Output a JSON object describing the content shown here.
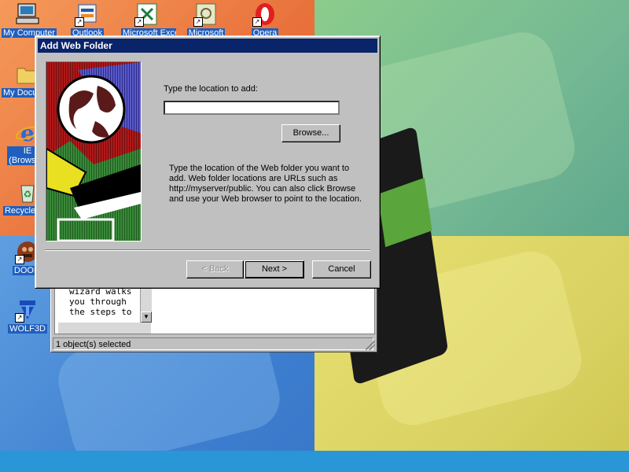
{
  "desktop": {
    "icons": [
      {
        "id": "my-computer",
        "label": "My Computer"
      },
      {
        "id": "outlook",
        "label": "Outlook"
      },
      {
        "id": "excel",
        "label": "Microsoft Excel"
      },
      {
        "id": "ms-other",
        "label": "Microsoft"
      },
      {
        "id": "opera",
        "label": "Opera"
      },
      {
        "id": "my-documents",
        "label": "My Documents"
      },
      {
        "id": "ie",
        "label": "IE (Browser)",
        "line1": "IE",
        "line2": "(Browser)"
      },
      {
        "id": "recycle",
        "label": "Recycle Bin"
      },
      {
        "id": "doom",
        "label": "DOOM"
      },
      {
        "id": "wolf3d",
        "label": "WOLF3D"
      }
    ]
  },
  "back_window": {
    "text_lines": [
      "wizard walks",
      "you through",
      "the steps to"
    ],
    "status": "1 object(s) selected"
  },
  "dialog": {
    "title": "Add Web Folder",
    "prompt_label": "Type the location to add:",
    "location_value": "",
    "browse_label": "Browse...",
    "description": "Type the location of the Web folder you want to add.  Web folder locations are URLs such as http://myserver/public.  You can also click Browse and use your Web browser to point to the location.",
    "buttons": {
      "back": "< Back",
      "next": "Next >",
      "cancel": "Cancel"
    }
  },
  "colors": {
    "titlebar": "#0a246a",
    "dialog_face": "#c0c0c0",
    "icon_label_selection": "#1f5fbf"
  }
}
